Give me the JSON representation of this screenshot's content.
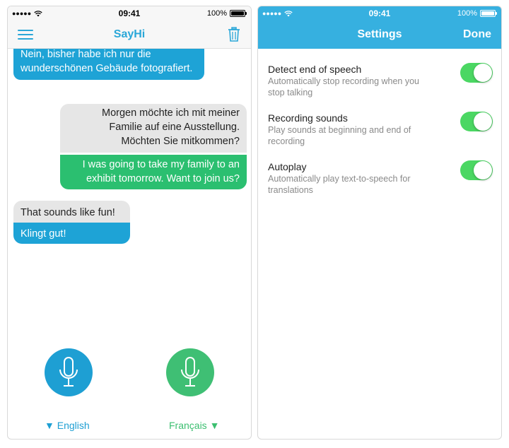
{
  "left_phone": {
    "status": {
      "carrier_dots": "●●●●●",
      "time": "09:41",
      "battery": "100%"
    },
    "nav": {
      "title": "SayHi"
    },
    "messages": [
      {
        "text": "Nein, bisher habe ich nur die wunderschönen Gebäude fotografiert.",
        "color": "#1ea3d6"
      },
      {
        "text": "Morgen möchte ich mit meiner Familie auf eine Ausstellung. Möchten Sie mitkommen?",
        "color": "#e6e6e6"
      },
      {
        "text": "I was going to take my family to an exhibit tomorrow. Want to join us?",
        "color": "#2bbf70"
      },
      {
        "text": "That sounds like fun!",
        "color": "#e6e6e6"
      },
      {
        "text": "Klingt gut!",
        "color": "#1ea3d6"
      }
    ],
    "languages": [
      {
        "label": "▼ English",
        "color": "#1e9fd3"
      },
      {
        "label": "Français ▼",
        "color": "#3fbf74"
      }
    ]
  },
  "right_phone": {
    "status": {
      "carrier_dots": "●●●●●",
      "time": "09:41",
      "battery": "100%"
    },
    "nav": {
      "title": "Settings",
      "done_label": "Done"
    },
    "settings": [
      {
        "title": "Detect end of speech",
        "description": "Automatically stop recording when you stop talking",
        "enabled": true
      },
      {
        "title": "Recording sounds",
        "description": "Play sounds at beginning and end of recording",
        "enabled": true
      },
      {
        "title": "Autoplay",
        "description": "Automatically play text-to-speech for translations",
        "enabled": true
      }
    ],
    "accent": "#36b0e0",
    "toggle_on_color": "#4bd763"
  }
}
